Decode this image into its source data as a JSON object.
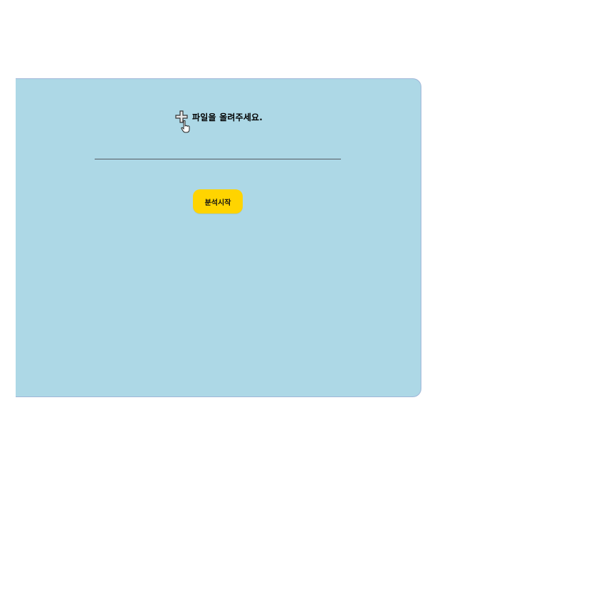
{
  "upload": {
    "icon": "plus-icon",
    "label": "파일을 올려주세요."
  },
  "actions": {
    "start_label": "분석시작"
  },
  "colors": {
    "panel_bg": "#add8e6",
    "button_bg": "#ffd400"
  }
}
